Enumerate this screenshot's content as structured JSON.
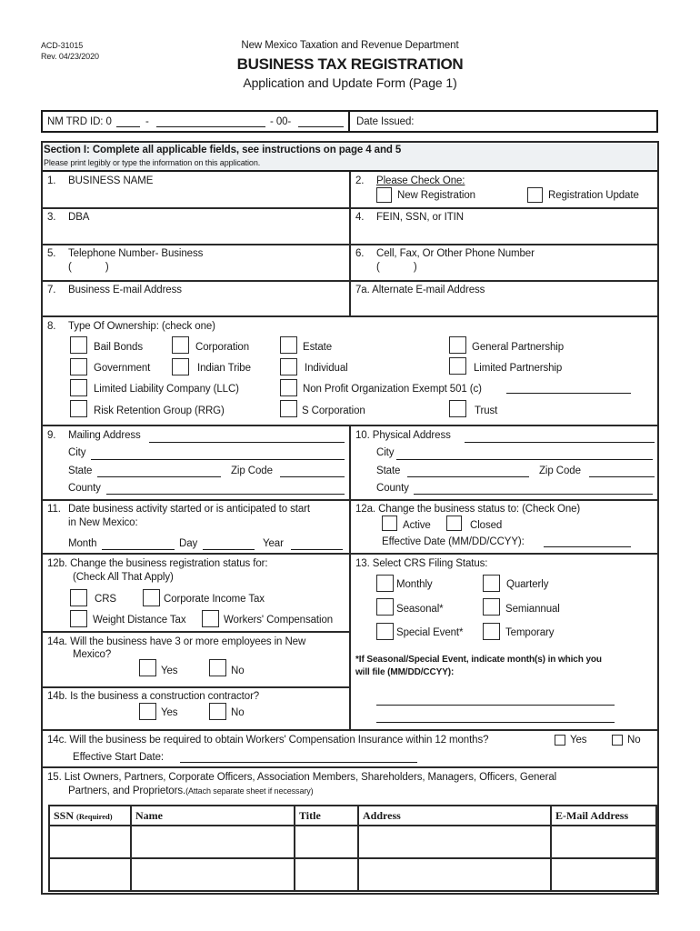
{
  "header": {
    "form_code": "ACD-31015",
    "revision": "Rev. 04/23/2020",
    "department": "New Mexico Taxation and Revenue Department",
    "title": "BUSINESS TAX REGISTRATION",
    "subtitle": "Application and Update Form (Page 1)"
  },
  "id_box": {
    "label": "NM TRD ID: 0",
    "sep1": "-",
    "sep2": "- 00-",
    "date_issued_label": "Date Issued:"
  },
  "section": {
    "title": "Section I: Complete all applicable fields, see instructions on page 4 and 5",
    "instruction": "Please print legibly or type the information on this application."
  },
  "fields": {
    "f1": {
      "num": "1.",
      "label": "BUSINESS NAME"
    },
    "f2": {
      "num": "2.",
      "label": "Please Check One:",
      "options": [
        "New Registration",
        "Registration Update"
      ]
    },
    "f3": {
      "num": "3.",
      "label": "DBA"
    },
    "f4": {
      "num": "4.",
      "label": "FEIN, SSN, or ITIN"
    },
    "f5": {
      "num": "5.",
      "label": "Telephone Number- Business",
      "paren": "(            )"
    },
    "f6": {
      "num": "6.",
      "label": "Cell, Fax, Or Other Phone Number",
      "paren": "(            )"
    },
    "f7": {
      "num": "7.",
      "label": "Business E-mail Address"
    },
    "f7a": {
      "label": "7a. Alternate E-mail Address"
    },
    "f8": {
      "num": "8.",
      "label": "Type Of Ownership: (check one)",
      "options": [
        "Bail Bonds",
        "Corporation",
        "Estate",
        "General Partnership",
        "Government",
        "Indian Tribe",
        "Individual",
        "Limited Partnership",
        "Limited Liability Company (LLC)",
        "Non Profit Organization Exempt 501 (c)",
        "Risk Retention Group (RRG)",
        "S Corporation",
        "Trust"
      ]
    },
    "f9": {
      "num": "9.",
      "label": "Mailing Address",
      "city": "City",
      "state": "State",
      "zip": "Zip Code",
      "county": "County"
    },
    "f10": {
      "label": "10. Physical Address",
      "city": "City",
      "state": "State",
      "zip": "Zip Code",
      "county": "County"
    },
    "f11": {
      "num": "11.",
      "label_line1": "Date business activity started or is anticipated to start",
      "label_line2": "in New Mexico:",
      "month": "Month",
      "day": "Day",
      "year": "Year"
    },
    "f12a": {
      "label": "12a. Change the business status to: (Check One)",
      "options": [
        "Active",
        "Closed"
      ],
      "effective_date": "Effective Date (MM/DD/CCYY):"
    },
    "f12b": {
      "label_line1": "12b. Change the business registration status for:",
      "label_line2": "(Check All That Apply)",
      "options": [
        "CRS",
        "Corporate Income Tax",
        "Weight Distance Tax",
        "Workers' Compensation"
      ]
    },
    "f13": {
      "label": "13. Select CRS Filing Status:",
      "options": [
        "Monthly",
        "Quarterly",
        "Seasonal*",
        "Semiannual",
        "Special Event*",
        "Temporary"
      ],
      "note_line1": "*If Seasonal/Special Event, indicate month(s) in which you",
      "note_line2": "will file (MM/DD/CCYY):"
    },
    "f14a": {
      "label_line1": "14a. Will the business have 3 or more employees in New",
      "label_line2": "Mexico?",
      "options": [
        "Yes",
        "No"
      ]
    },
    "f14b": {
      "label": "14b. Is the business a construction contractor?",
      "options": [
        "Yes",
        "No"
      ]
    },
    "f14c": {
      "label": "14c. Will the business be required to obtain Workers' Compensation Insurance within 12 months?",
      "options": [
        "Yes",
        "No"
      ],
      "start_date": "Effective Start Date:"
    },
    "f15": {
      "label_line1": "15. List Owners, Partners, Corporate Officers, Association Members, Shareholders, Managers, Officers, General",
      "label_line2": "Partners, and Proprietors.",
      "note": "(Attach separate sheet if necessary)"
    }
  },
  "owners_table": {
    "columns": [
      {
        "label": "SSN",
        "qualifier": "(Required)"
      },
      {
        "label": "Name"
      },
      {
        "label": "Title"
      },
      {
        "label": "Address"
      },
      {
        "label": "E-Mail Address"
      }
    ],
    "rows": [
      [
        "",
        "",
        "",
        "",
        ""
      ],
      [
        "",
        "",
        "",
        "",
        ""
      ]
    ]
  }
}
